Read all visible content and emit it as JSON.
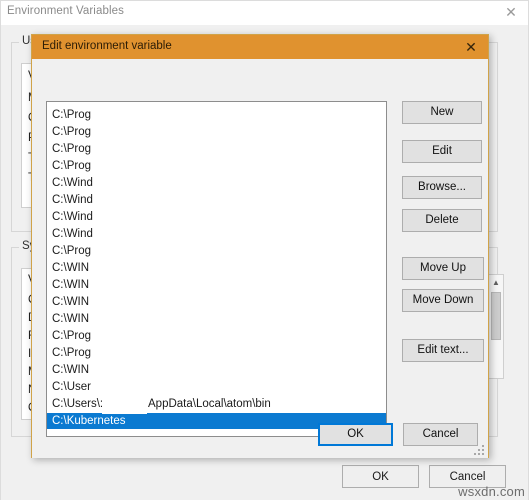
{
  "background_window": {
    "title": "Environment Variables",
    "close_icon": "close-icon",
    "user_group": {
      "legend": "User variables for",
      "rows": [
        "Va",
        "M",
        "Or",
        "Pa",
        "TE",
        "TM"
      ]
    },
    "system_group": {
      "legend": "System variables",
      "rows": [
        "Va",
        "Co",
        "Dr",
        "FP",
        "IN",
        "M",
        "NU",
        "OS"
      ]
    },
    "scrollbar": {
      "up_arrow": "chevron-up-icon"
    },
    "buttons": {
      "ok": "OK",
      "cancel": "Cancel"
    }
  },
  "dialog": {
    "title": "Edit environment variable",
    "close_icon": "close-icon",
    "accent_color": "#e0922f",
    "selection_color": "#0b7ad1",
    "path_entries": [
      {
        "text": "C:\\Prog",
        "selected": false
      },
      {
        "text": "C:\\Prog",
        "selected": false
      },
      {
        "text": "C:\\Prog",
        "selected": false
      },
      {
        "text": "C:\\Prog",
        "selected": false
      },
      {
        "text": "C:\\Wind",
        "selected": false
      },
      {
        "text": "C:\\Wind",
        "selected": false
      },
      {
        "text": "C:\\Wind",
        "selected": false
      },
      {
        "text": "C:\\Wind",
        "selected": false
      },
      {
        "text": "C:\\Prog",
        "selected": false
      },
      {
        "text": "C:\\WIN",
        "selected": false
      },
      {
        "text": "C:\\WIN",
        "selected": false
      },
      {
        "text": "C:\\WIN",
        "selected": false
      },
      {
        "text": "C:\\WIN",
        "selected": false
      },
      {
        "text": "C:\\Prog",
        "selected": false
      },
      {
        "text": "C:\\Prog",
        "selected": false
      },
      {
        "text": "C:\\WIN",
        "selected": false
      },
      {
        "text": "C:\\User",
        "selected": false
      },
      {
        "text": "C:\\Users\\:",
        "selected": false
      },
      {
        "text": "C:\\Kubernetes",
        "selected": true
      }
    ],
    "partial_path_suffix": "AppData\\Local\\atom\\bin",
    "side_buttons": {
      "new": "New",
      "edit": "Edit",
      "browse": "Browse...",
      "delete": "Delete",
      "move_up": "Move Up",
      "move_down": "Move Down",
      "edit_text": "Edit text..."
    },
    "footer_buttons": {
      "ok": "OK",
      "cancel": "Cancel"
    }
  },
  "watermark": "wsxdn.com"
}
